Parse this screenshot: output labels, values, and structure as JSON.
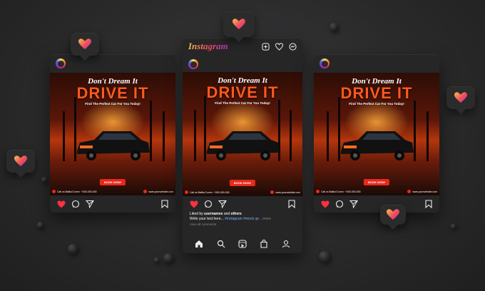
{
  "app": {
    "logo": "Instagram"
  },
  "post": {
    "tagline": "Don't Dream It",
    "headline": "DRIVE IT",
    "subline": "Find The Perfect Car For You Today!",
    "cta": "BOOK NOW!",
    "phone_label": "Call us BaBurComm",
    "phone": "+000-000-000",
    "website": "www.yourwebsite.com"
  },
  "center_feed": {
    "liked_by_prefix": "Liked by",
    "liked_by_user": "usernames",
    "liked_by_middle": "and",
    "liked_by_others": "others",
    "caption_prefix": "Write your text here...",
    "caption_tags": "#instagram #mock up",
    "caption_more": "...more",
    "view_comments": "View all comments"
  },
  "colors": {
    "accent": "#e8291c",
    "headline": "#ff5a1a",
    "like": "#ff3040"
  },
  "icons": [
    "heart-icon",
    "comment-icon",
    "share-icon",
    "bookmark-icon",
    "home-icon",
    "search-icon",
    "reels-icon",
    "shop-icon",
    "profile-icon",
    "add-post-icon",
    "activity-heart-icon",
    "messenger-icon"
  ]
}
